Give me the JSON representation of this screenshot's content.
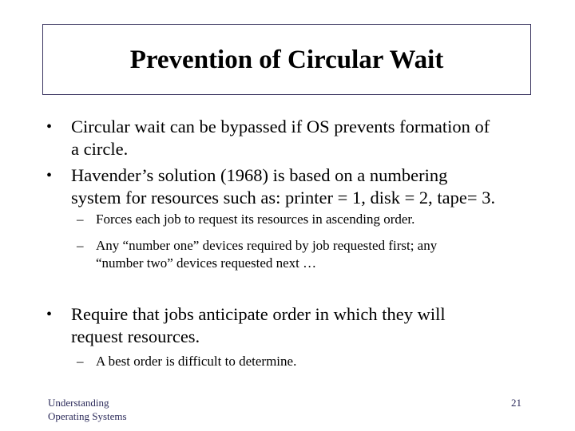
{
  "slide": {
    "title": "Prevention of Circular Wait",
    "bullets": [
      {
        "marker": "•",
        "lines": [
          "Circular wait can be bypassed if OS prevents formation of",
          "a circle."
        ]
      },
      {
        "marker": "•",
        "lines": [
          "Havender’s solution (1968) is based on a numbering",
          "system for resources such as: printer = 1, disk = 2, tape= 3."
        ],
        "sub_bullets": [
          {
            "marker": "–",
            "lines": [
              "Forces each job to request its resources in ascending order."
            ]
          },
          {
            "marker": "–",
            "lines": [
              "Any “number one” devices required by job requested first; any",
              "“number two” devices  requested next …"
            ]
          }
        ]
      },
      {
        "marker": "•",
        "lines": [
          "Require that jobs anticipate order in which they will",
          "request resources."
        ],
        "sub_bullets": [
          {
            "marker": "–",
            "lines": [
              "A best order is difficult to determine."
            ]
          }
        ]
      }
    ]
  },
  "footer": {
    "left_lines": [
      "Understanding",
      "Operating Systems"
    ],
    "page_number": "21"
  },
  "colors": {
    "title_border": "#3a3560",
    "footer_text": "#2b2a5a",
    "body_text": "#000000",
    "background": "#ffffff"
  }
}
